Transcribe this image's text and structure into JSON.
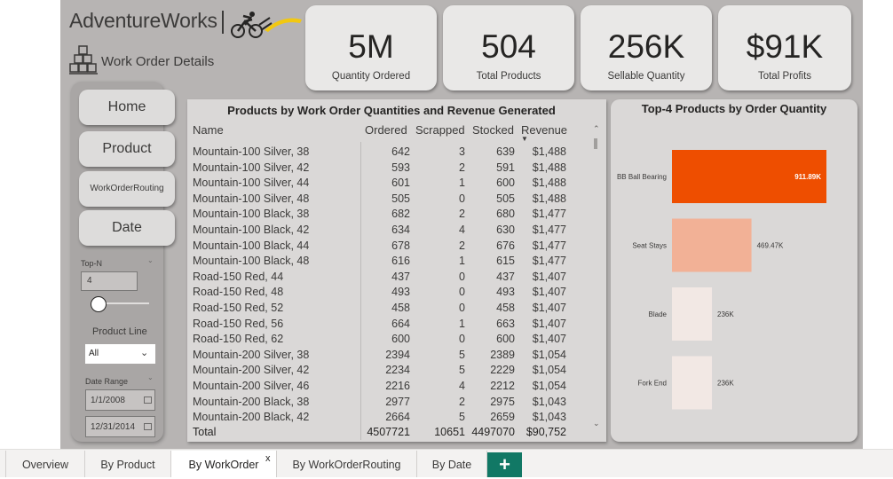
{
  "header": {
    "brand": "AdventureWorks",
    "page_title": "Work Order Details"
  },
  "kpis": [
    {
      "value": "5M",
      "label": "Quantity Ordered"
    },
    {
      "value": "504",
      "label": "Total Products"
    },
    {
      "value": "256K",
      "label": "Sellable Quantity"
    },
    {
      "value": "$91K",
      "label": "Total Profits"
    }
  ],
  "nav": {
    "home": "Home",
    "product": "Product",
    "routing": "WorkOrderRouting",
    "date": "Date"
  },
  "filters": {
    "topn_label": "Top-N",
    "topn_value": "4",
    "topn_slider_fraction": 0.0,
    "product_line_label": "Product Line",
    "product_line_value": "All",
    "date_range_label": "Date Range",
    "date_start": "1/1/2008",
    "date_end": "12/31/2014"
  },
  "table": {
    "title": "Products by Work Order Quantities and Revenue Generated",
    "headers": [
      "Name",
      "Ordered",
      "Scrapped",
      "Stocked",
      "Revenue"
    ],
    "rows": [
      [
        "Mountain-100 Silver, 38",
        "642",
        "3",
        "639",
        "$1,488"
      ],
      [
        "Mountain-100 Silver, 42",
        "593",
        "2",
        "591",
        "$1,488"
      ],
      [
        "Mountain-100 Silver, 44",
        "601",
        "1",
        "600",
        "$1,488"
      ],
      [
        "Mountain-100 Silver, 48",
        "505",
        "0",
        "505",
        "$1,488"
      ],
      [
        "Mountain-100 Black, 38",
        "682",
        "2",
        "680",
        "$1,477"
      ],
      [
        "Mountain-100 Black, 42",
        "634",
        "4",
        "630",
        "$1,477"
      ],
      [
        "Mountain-100 Black, 44",
        "678",
        "2",
        "676",
        "$1,477"
      ],
      [
        "Mountain-100 Black, 48",
        "616",
        "1",
        "615",
        "$1,477"
      ],
      [
        "Road-150 Red, 44",
        "437",
        "0",
        "437",
        "$1,407"
      ],
      [
        "Road-150 Red, 48",
        "493",
        "0",
        "493",
        "$1,407"
      ],
      [
        "Road-150 Red, 52",
        "458",
        "0",
        "458",
        "$1,407"
      ],
      [
        "Road-150 Red, 56",
        "664",
        "1",
        "663",
        "$1,407"
      ],
      [
        "Road-150 Red, 62",
        "600",
        "0",
        "600",
        "$1,407"
      ],
      [
        "Mountain-200 Silver, 38",
        "2394",
        "5",
        "2389",
        "$1,054"
      ],
      [
        "Mountain-200 Silver, 42",
        "2234",
        "5",
        "2229",
        "$1,054"
      ],
      [
        "Mountain-200 Silver, 46",
        "2216",
        "4",
        "2212",
        "$1,054"
      ],
      [
        "Mountain-200 Black, 38",
        "2977",
        "2",
        "2975",
        "$1,043"
      ],
      [
        "Mountain-200 Black, 42",
        "2664",
        "5",
        "2659",
        "$1,043"
      ]
    ],
    "total": [
      "Total",
      "4507721",
      "10651",
      "4497070",
      "$90,752"
    ]
  },
  "chart_data": {
    "type": "bar",
    "orientation": "horizontal",
    "title": "Top-4 Products by Order Quantity",
    "categories": [
      "BB Ball Bearing",
      "Seat Stays",
      "Blade",
      "Fork End"
    ],
    "values": [
      911890,
      469470,
      236000,
      236000
    ],
    "data_labels": [
      "911.89K",
      "469.47K",
      "236K",
      "236K"
    ],
    "colors": [
      "#ee4e00",
      "#f2b196",
      "#f2e8e4",
      "#f2e8e4"
    ],
    "xlim": [
      0,
      911890
    ],
    "grid": false
  },
  "tabs": [
    {
      "label": "Overview"
    },
    {
      "label": "By Product"
    },
    {
      "label": "By WorkOrder"
    },
    {
      "label": "By WorkOrderRouting"
    },
    {
      "label": "By Date"
    }
  ],
  "tab_close": "x",
  "add_tab": "+"
}
